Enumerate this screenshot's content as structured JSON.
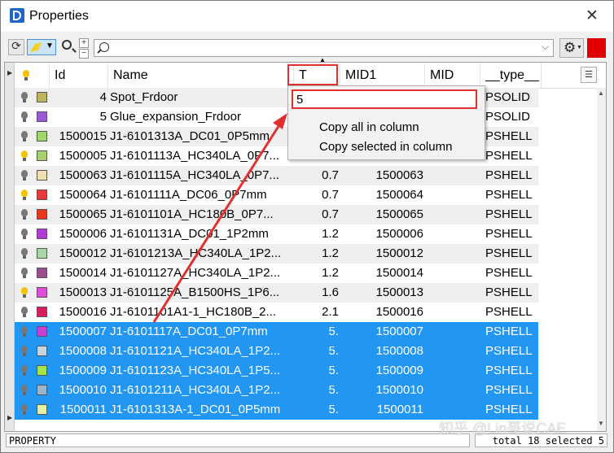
{
  "window": {
    "title": "Properties",
    "close_glyph": "✕"
  },
  "toolbar": {
    "refresh_icon": "refresh-icon",
    "highlight_icon": "highlight-icon",
    "zoom_icon": "zoom-icon",
    "plus_glyph": "+",
    "minus_glyph": "−",
    "search_value": "",
    "gear_icon": "gear-icon"
  },
  "table": {
    "columns": [
      "Id",
      "Name",
      "T",
      "MID1",
      "MID",
      "__type__"
    ],
    "rows": [
      {
        "bulb": "off",
        "color": "#bfb35e",
        "id": "4",
        "name": "Spot_Frdoor",
        "t": "",
        "mid1": "",
        "type": "PSOLID",
        "selected": false
      },
      {
        "bulb": "off",
        "color": "#9b59d9",
        "id": "5",
        "name": "Glue_expansion_Frdoor",
        "t": "",
        "mid1": "",
        "type": "PSOLID",
        "selected": false
      },
      {
        "bulb": "off",
        "color": "#9fd86a",
        "id": "1500015",
        "name": "J1-6101313A_DC01_0P5mm",
        "t": "",
        "mid1": "",
        "type": "PSHELL",
        "selected": false
      },
      {
        "bulb": "on",
        "color": "#a8d070",
        "id": "1500005",
        "name": "J1-6101113A_HC340LA_0P7...",
        "t": "",
        "mid1": "",
        "type": "PSHELL",
        "selected": false
      },
      {
        "bulb": "off",
        "color": "#f0dfb0",
        "id": "1500063",
        "name": "J1-6101115A_HC340LA_0P7...",
        "t": "0.7",
        "mid1": "1500063",
        "type": "PSHELL",
        "selected": false
      },
      {
        "bulb": "on",
        "color": "#e83a3a",
        "id": "1500064",
        "name": "J1-6101111A_DC06_0P7mm",
        "t": "0.7",
        "mid1": "1500064",
        "type": "PSHELL",
        "selected": false
      },
      {
        "bulb": "off",
        "color": "#e8391f",
        "id": "1500065",
        "name": "J1-6101101A_HC180B_0P7...",
        "t": "0.7",
        "mid1": "1500065",
        "type": "PSHELL",
        "selected": false
      },
      {
        "bulb": "off",
        "color": "#b43ad8",
        "id": "1500006",
        "name": "J1-6101131A_DC01_1P2mm",
        "t": "1.2",
        "mid1": "1500006",
        "type": "PSHELL",
        "selected": false
      },
      {
        "bulb": "off",
        "color": "#a8d8a8",
        "id": "1500012",
        "name": "J1-6101213A_HC340LA_1P2...",
        "t": "1.2",
        "mid1": "1500012",
        "type": "PSHELL",
        "selected": false
      },
      {
        "bulb": "off",
        "color": "#9b4e8e",
        "id": "1500014",
        "name": "J1-6101127A_HC340LA_1P2...",
        "t": "1.2",
        "mid1": "1500014",
        "type": "PSHELL",
        "selected": false
      },
      {
        "bulb": "on",
        "color": "#e04cd8",
        "id": "1500013",
        "name": "J1-6101125A_B1500HS_1P6...",
        "t": "1.6",
        "mid1": "1500013",
        "type": "PSHELL",
        "selected": false
      },
      {
        "bulb": "off",
        "color": "#d81e5a",
        "id": "1500016",
        "name": "J1-6101101A1-1_HC180B_2...",
        "t": "2.1",
        "mid1": "1500016",
        "type": "PSHELL",
        "selected": false
      },
      {
        "bulb": "off",
        "color": "#c63fd0",
        "id": "1500007",
        "name": "J1-6101117A_DC01_0P7mm",
        "t": "5.",
        "mid1": "1500007",
        "type": "PSHELL",
        "selected": true
      },
      {
        "bulb": "off",
        "color": "#c8d4dc",
        "id": "1500008",
        "name": "J1-6101121A_HC340LA_1P2...",
        "t": "5.",
        "mid1": "1500008",
        "type": "PSHELL",
        "selected": true
      },
      {
        "bulb": "off",
        "color": "#a6e24a",
        "id": "1500009",
        "name": "J1-6101123A_HC340LA_1P5...",
        "t": "5.",
        "mid1": "1500009",
        "type": "PSHELL",
        "selected": true
      },
      {
        "bulb": "off",
        "color": "#9fb4c4",
        "id": "1500010",
        "name": "J1-6101211A_HC340LA_1P2...",
        "t": "5.",
        "mid1": "1500010",
        "type": "PSHELL",
        "selected": true
      },
      {
        "bulb": "off",
        "color": "#e6f0a0",
        "id": "1500011",
        "name": "J1-6101313A-1_DC01_0P5mm",
        "t": "5.",
        "mid1": "1500011",
        "type": "PSHELL",
        "selected": true
      }
    ]
  },
  "popup": {
    "input_value": "5",
    "items": [
      "Copy all in column",
      "Copy selected in column"
    ]
  },
  "status": {
    "left": "PROPERTY",
    "right": "total 18 selected 5"
  },
  "watermark": "知乎 @Lin哥说CAE",
  "annotation_color": "#e03030"
}
